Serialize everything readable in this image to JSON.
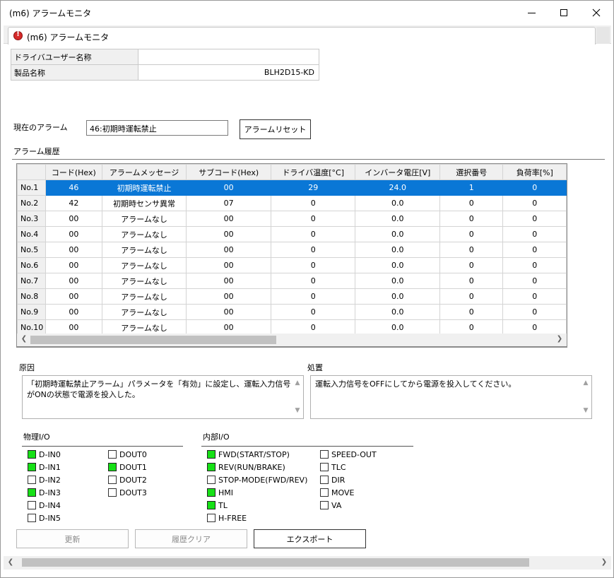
{
  "window": {
    "title": "(m6) アラームモニタ"
  },
  "tab": {
    "label": "(m6) アラームモニタ"
  },
  "info": [
    {
      "key": "ドライバユーザー名称",
      "value": ""
    },
    {
      "key": "製品名称",
      "value": "BLH2D15-KD"
    }
  ],
  "current": {
    "label": "現在のアラーム",
    "value": "46:初期時運転禁止",
    "reset_label": "アラームリセット"
  },
  "history": {
    "label": "アラーム履歴",
    "columns": [
      "",
      "コード(Hex)",
      "アラームメッセージ",
      "サブコード(Hex)",
      "ドライバ温度[°C]",
      "インバータ電圧[V]",
      "選択番号",
      "負荷率[%]"
    ],
    "rows": [
      [
        "No.1",
        "46",
        "初期時運転禁止",
        "00",
        "29",
        "24.0",
        "1",
        "0"
      ],
      [
        "No.2",
        "42",
        "初期時センサ異常",
        "07",
        "0",
        "0.0",
        "0",
        "0"
      ],
      [
        "No.3",
        "00",
        "アラームなし",
        "00",
        "0",
        "0.0",
        "0",
        "0"
      ],
      [
        "No.4",
        "00",
        "アラームなし",
        "00",
        "0",
        "0.0",
        "0",
        "0"
      ],
      [
        "No.5",
        "00",
        "アラームなし",
        "00",
        "0",
        "0.0",
        "0",
        "0"
      ],
      [
        "No.6",
        "00",
        "アラームなし",
        "00",
        "0",
        "0.0",
        "0",
        "0"
      ],
      [
        "No.7",
        "00",
        "アラームなし",
        "00",
        "0",
        "0.0",
        "0",
        "0"
      ],
      [
        "No.8",
        "00",
        "アラームなし",
        "00",
        "0",
        "0.0",
        "0",
        "0"
      ],
      [
        "No.9",
        "00",
        "アラームなし",
        "00",
        "0",
        "0.0",
        "0",
        "0"
      ],
      [
        "No.10",
        "00",
        "アラームなし",
        "00",
        "0",
        "0.0",
        "0",
        "0"
      ]
    ],
    "selected_row": 0
  },
  "cause": {
    "label": "原因",
    "text": "「初期時運転禁止アラーム」パラメータを「有効」に設定し、運転入力信号がONの状態で電源を投入した。"
  },
  "action": {
    "label": "処置",
    "text": "運転入力信号をOFFにしてから電源を投入してください。"
  },
  "physical_io": {
    "label": "物理I/O",
    "col1": [
      {
        "name": "D-IN0",
        "on": true
      },
      {
        "name": "D-IN1",
        "on": true
      },
      {
        "name": "D-IN2",
        "on": false
      },
      {
        "name": "D-IN3",
        "on": true
      },
      {
        "name": "D-IN4",
        "on": false
      },
      {
        "name": "D-IN5",
        "on": false
      }
    ],
    "col2": [
      {
        "name": "DOUT0",
        "on": false
      },
      {
        "name": "DOUT1",
        "on": true
      },
      {
        "name": "DOUT2",
        "on": false
      },
      {
        "name": "DOUT3",
        "on": false
      }
    ]
  },
  "internal_io": {
    "label": "内部I/O",
    "col1": [
      {
        "name": "FWD(START/STOP)",
        "on": true
      },
      {
        "name": "REV(RUN/BRAKE)",
        "on": true
      },
      {
        "name": "STOP-MODE(FWD/REV)",
        "on": false
      },
      {
        "name": "HMI",
        "on": true
      },
      {
        "name": "TL",
        "on": true
      },
      {
        "name": "H-FREE",
        "on": false
      }
    ],
    "col2": [
      {
        "name": "SPEED-OUT",
        "on": false
      },
      {
        "name": "TLC",
        "on": false
      },
      {
        "name": "DIR",
        "on": false
      },
      {
        "name": "MOVE",
        "on": false
      },
      {
        "name": "VA",
        "on": false
      }
    ]
  },
  "buttons": {
    "update": "更新",
    "clear_history": "履歴クリア",
    "export": "エクスポート"
  },
  "colors": {
    "selection": "#0a77d6",
    "io_on": "#16e016"
  }
}
